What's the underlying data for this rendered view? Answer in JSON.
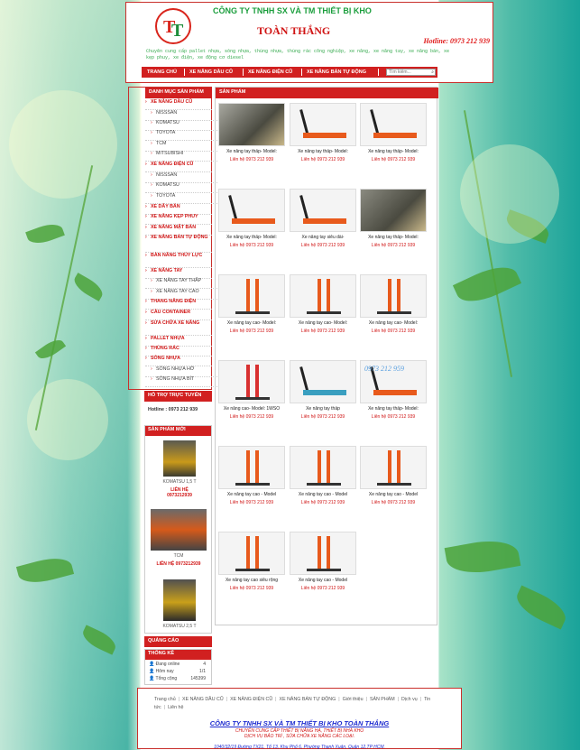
{
  "header": {
    "company_name": "CÔNG TY TNHH SX VÀ TM THIẾT BỊ KHO",
    "brand": "TOÀN THẮNG",
    "hotline": "Hotline: 0973 212 939",
    "slogan": "Chuyên cung cấp pallet nhựa, sóng nhựa, thùng nhựa, thùng rác công nghiệp, xe nâng, xe nâng tay, xe nâng bán, xe kẹp phuy, xe điện, xe động cơ diesel"
  },
  "nav": {
    "items": [
      "TRANG CHỦ",
      "XE NÂNG DẦU CŨ",
      "XE NÂNG ĐIỆN CŨ",
      "XE NÂNG BÁN TỰ ĐỘNG"
    ],
    "search_placeholder": "Tìm kiếm..."
  },
  "sidebar": {
    "categories_title": "DANH MỤC SẢN PHẨM",
    "categories": [
      {
        "label": "XE NÂNG DẦU CŨ",
        "level": "main"
      },
      {
        "label": "NISSSAN",
        "level": "sub"
      },
      {
        "label": "KOMATSU",
        "level": "sub"
      },
      {
        "label": "TOYOTA",
        "level": "sub"
      },
      {
        "label": "TCM",
        "level": "sub"
      },
      {
        "label": "MITSUBISHI",
        "level": "sub"
      },
      {
        "label": "XE NÂNG ĐIỆN CŨ",
        "level": "main"
      },
      {
        "label": "NISSSAN",
        "level": "sub"
      },
      {
        "label": "KOMATSU",
        "level": "sub"
      },
      {
        "label": "TOYOTA",
        "level": "sub"
      },
      {
        "label": "XE DẮY BÁN",
        "level": "main"
      },
      {
        "label": "XE NÂNG KẸP PHUY",
        "level": "main"
      },
      {
        "label": "XE NÂNG MẶT BÀN",
        "level": "main"
      },
      {
        "label": "XE NÂNG BÁN TỰ ĐỘNG",
        "level": "main"
      },
      {
        "label": "BÀN NÂNG THỦY LỰC",
        "level": "main"
      },
      {
        "label": "XE NÂNG TAY",
        "level": "main"
      },
      {
        "label": "XE NÂNG TAY THẤP",
        "level": "sub"
      },
      {
        "label": "XE NÂNG TAY CAO",
        "level": "sub"
      },
      {
        "label": "THANG NÂNG ĐIỆN",
        "level": "main"
      },
      {
        "label": "CẦU CONTAINER",
        "level": "main"
      },
      {
        "label": "SỬA CHỮA XE NÂNG",
        "level": "main"
      },
      {
        "label": "PALLET NHỰA",
        "level": "main"
      },
      {
        "label": "THÙNG RÁC",
        "level": "main"
      },
      {
        "label": "SÓNG NHỰA",
        "level": "main"
      },
      {
        "label": "SÓNG NHỰA HỞ",
        "level": "sub"
      },
      {
        "label": "SÓNG NHỰA BÍT",
        "level": "sub"
      }
    ],
    "support_title": "HỖ TRỢ TRỰC TUYẾN",
    "support_hotline": "Hotline : 0973 212 939",
    "new_title": "SẢN PHẨM MỚI",
    "new_products": [
      {
        "name": "KOMATSU 1,5 T",
        "phone": "LIÊN HỆ 0973212939"
      },
      {
        "name": "TCM",
        "phone": "LIÊN HỆ 0973212939"
      },
      {
        "name": "KOMATSU 2,5 T",
        "phone": ""
      }
    ],
    "ads_title": "QUẢNG CÁO",
    "stats_title": "THỐNG KÊ",
    "stats": [
      {
        "label": "Đang online",
        "value": "4"
      },
      {
        "label": "Hôm nay",
        "value": "1/1"
      },
      {
        "label": "Tổng cộng",
        "value": "145399"
      }
    ]
  },
  "main": {
    "title": "SẢN PHẨM",
    "products": [
      {
        "name": "Xe nâng tay thấp- Model:",
        "phone": "Liên hệ 0973 212 939",
        "color": "#a8a8a0",
        "photo": true
      },
      {
        "name": "Xe nâng tay thấp- Model:",
        "phone": "Liên hệ 0973 212 939",
        "color": "#e85a1c",
        "photo": false
      },
      {
        "name": "Xe nâng tay thấp- Model:",
        "phone": "Liên hệ 0973 212 939",
        "color": "#e85a1c",
        "photo": false
      },
      {
        "name": "Xe nâng tay thấp- Model:",
        "phone": "Liên hệ 0973 212 939",
        "color": "#e85a1c",
        "photo": false
      },
      {
        "name": "Xe nâng tay siêu dài-",
        "phone": "Liên hệ 0973 212 939",
        "color": "#e85a1c",
        "photo": false
      },
      {
        "name": "Xe nâng tay thấp- Model:",
        "phone": "Liên hệ 0973 212 939",
        "color": "#8a8a80",
        "photo": true
      },
      {
        "name": "Xe nâng tay cao- Model:",
        "phone": "Liên hệ 0973 212 939",
        "color": "#e85a1c",
        "photo": false
      },
      {
        "name": "Xe nâng tay cao- Model:",
        "phone": "Liên hệ 0973 212 939",
        "color": "#e85a1c",
        "photo": false
      },
      {
        "name": "Xe nâng tay cao- Model:",
        "phone": "Liên hệ 0973 212 939",
        "color": "#e85a1c",
        "photo": false
      },
      {
        "name": "Xe nâng cao- Model: 1WSO",
        "phone": "Liên hệ 0973 212 939",
        "color": "#d83030",
        "photo": false
      },
      {
        "name": "Xe nâng tay thấp",
        "phone": "Liên hệ 0973 212 939",
        "color": "#3a9fc0",
        "photo": false
      },
      {
        "name": "Xe nâng tay thấp- Model:",
        "phone": "Liên hệ 0973 212 939",
        "color": "#e85a1c",
        "photo": false,
        "watermark": "0973 212 959"
      },
      {
        "name": "Xe nâng tay cao - Model",
        "phone": "Liên hệ 0973 212 939",
        "color": "#e85a1c",
        "photo": false
      },
      {
        "name": "Xe nâng tay cao - Model",
        "phone": "Liên hệ 0973 212 939",
        "color": "#e85a1c",
        "photo": false
      },
      {
        "name": "Xe nâng tay cao - Model",
        "phone": "Liên hệ 0973 212 939",
        "color": "#e85a1c",
        "photo": false
      },
      {
        "name": "Xe nâng tay cao siêu rộng",
        "phone": "Liên hệ 0973 212 939",
        "color": "#e85a1c",
        "photo": false
      },
      {
        "name": "Xe nâng tay cao - Model",
        "phone": "Liên hệ 0973 212 939",
        "color": "#e85a1c",
        "photo": false
      }
    ]
  },
  "footer": {
    "links": [
      "Trang chủ",
      "XE NÂNG DẦU CŨ",
      "XE NÂNG ĐIỆN CŨ",
      "XE NÂNG BÁN TỰ ĐỘNG",
      "Giới thiệu",
      "SẢN PHẨM",
      "Dịch vụ",
      "Tin tức",
      "Liên hệ"
    ],
    "company": "CÔNG TY TNHH SX VÀ TM THIẾT BỊ KHO TOÀN THẮNG",
    "line1": "CHUYÊN CUNG CẤP THIẾT BỊ NÂNG HẠ, THIẾT BỊ NHÀ KHO",
    "line2": "DỊCH VỤ BẢO TRÌ , SỬA CHỮA XE NÂNG CÁC LOẠI.",
    "address": "1040/32/19 Đường TX21, Tổ 13, Khu Phố 6, Phường Thạnh Xuân, Quận 12,TP HCM."
  },
  "colors": {
    "accent": "#d12020",
    "brand_green": "#1b9e3d",
    "link_blue": "#1d2bcf"
  }
}
